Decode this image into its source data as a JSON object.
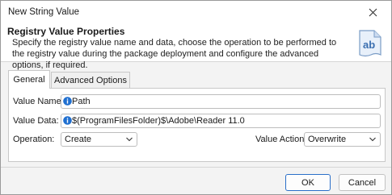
{
  "window": {
    "title": "New String Value",
    "close_icon": "close-icon"
  },
  "header": {
    "title": "Registry Value Properties",
    "description": "Specify the registry value name and data, choose the operation to be performed to the registry value during the package deployment and configure the advanced options, if required.",
    "icon": "string-value-ab-icon",
    "icon_text": "ab"
  },
  "tabs": [
    {
      "label": "General",
      "active": true
    },
    {
      "label": "Advanced Options",
      "active": false
    }
  ],
  "form": {
    "value_name_label": "Value Name:",
    "value_name": "Path",
    "value_data_label": "Value Data:",
    "value_data": "$(ProgramFilesFolder)$\\Adobe\\Reader 11.0",
    "operation_label": "Operation:",
    "operation": "Create",
    "value_action_label": "Value Action:",
    "value_action": "Overwrite"
  },
  "buttons": {
    "ok": "OK",
    "cancel": "Cancel"
  },
  "colors": {
    "accent": "#2a6fc9",
    "info": "#1f6fd0"
  }
}
